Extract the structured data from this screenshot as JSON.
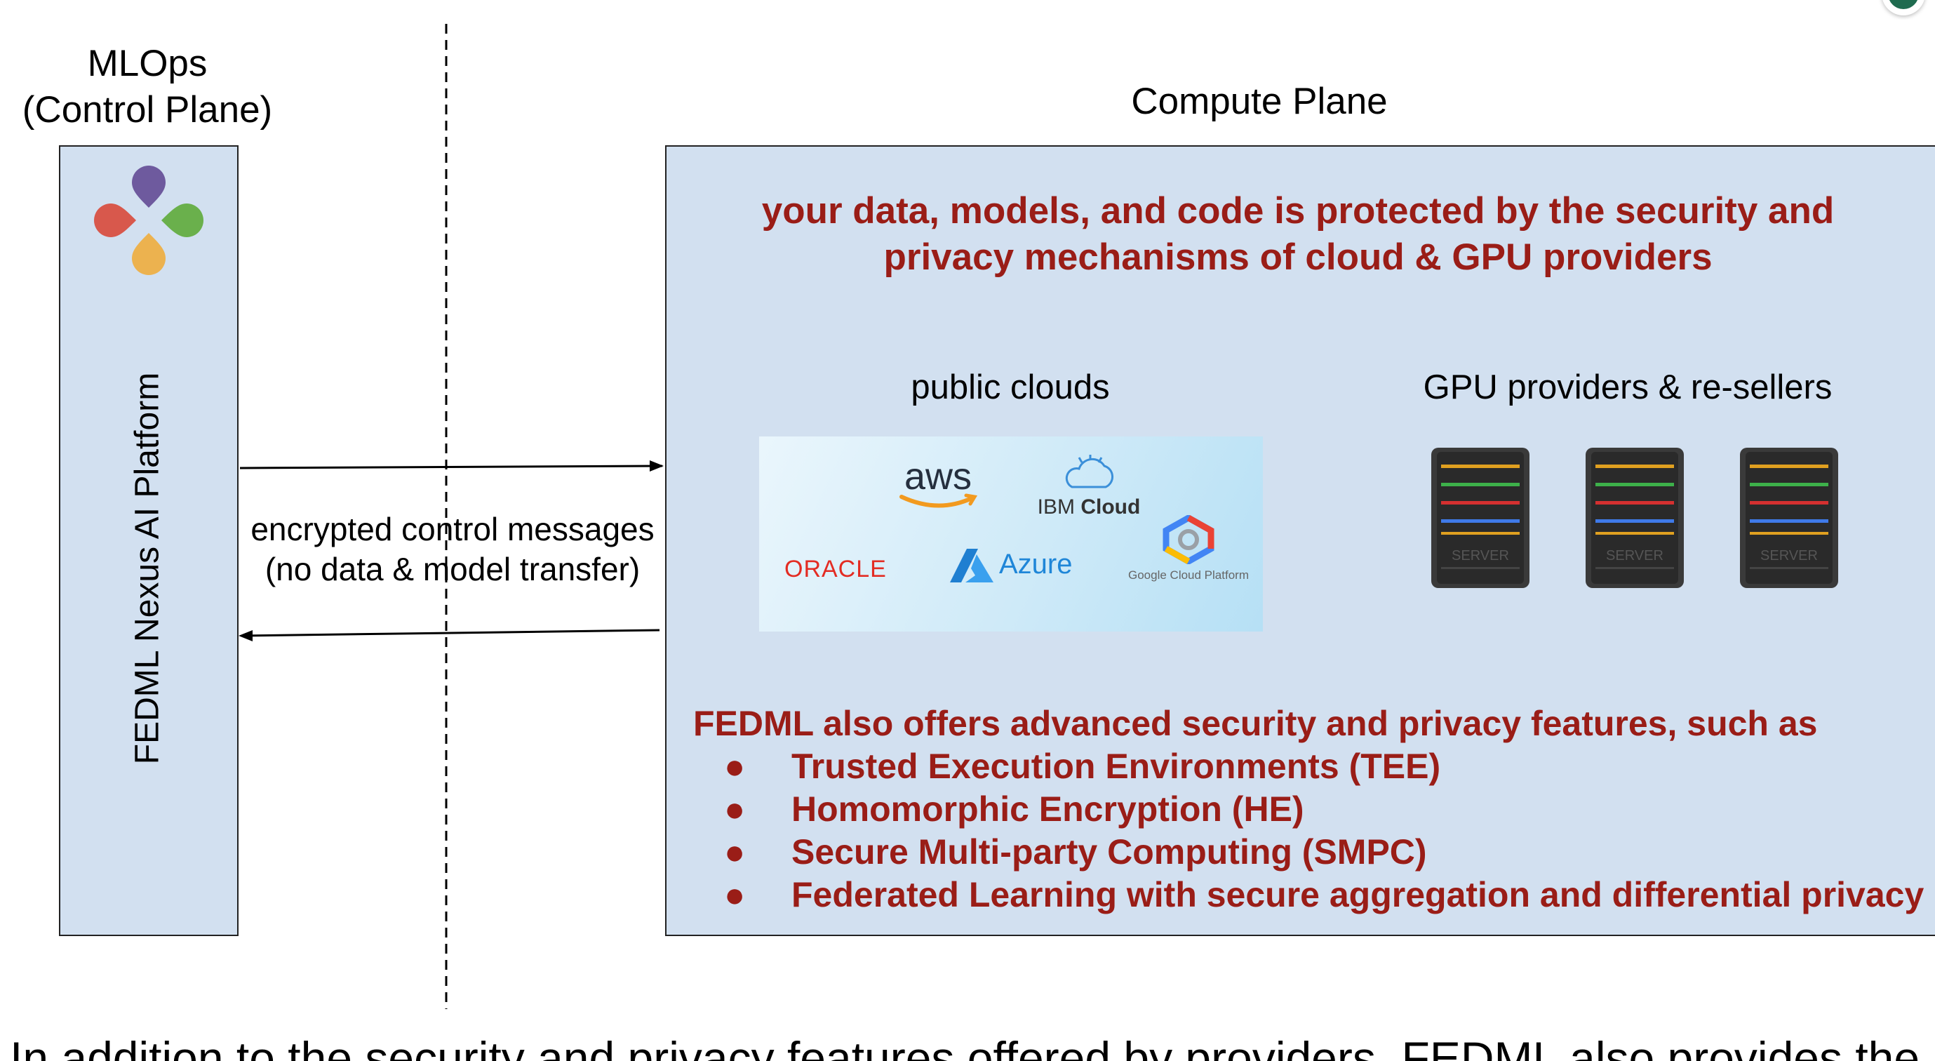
{
  "control_plane": {
    "heading_line1": "MLOps",
    "heading_line2": "(Control Plane)",
    "platform_label": "FEDML Nexus AI Platform",
    "logo_colors": [
      "#6e5a9e",
      "#d8584c",
      "#6ab04c",
      "#ecb24f"
    ]
  },
  "compute_plane": {
    "heading": "Compute Plane",
    "protection_line1": "your data, models, and code is protected by the security and",
    "protection_line2": "privacy mechanisms of cloud & GPU providers",
    "public_clouds_label": "public clouds",
    "gpu_label": "GPU providers & re-sellers",
    "providers": {
      "aws": "aws",
      "ibm_prefix": "IBM",
      "ibm_suffix": "Cloud",
      "oracle": "ORACLE",
      "azure": "Azure",
      "google": "Google Cloud Platform"
    },
    "server_label": "SERVER",
    "features_intro": "FEDML also offers advanced security and privacy features, such as",
    "features": [
      "Trusted Execution Environments (TEE)",
      "Homomorphic Encryption (HE)",
      "Secure Multi-party Computing (SMPC)",
      "Federated Learning with secure aggregation and differential privacy"
    ],
    "bullet": "●"
  },
  "messages": {
    "line1": "encrypted control messages",
    "line2": "(no data & model transfer)"
  },
  "bottom_text": "In addition to the security and privacy features offered by providers, FEDML also provides the",
  "colors": {
    "panel_fill": "#d2e0f0",
    "accent_red": "#9a1d17"
  }
}
